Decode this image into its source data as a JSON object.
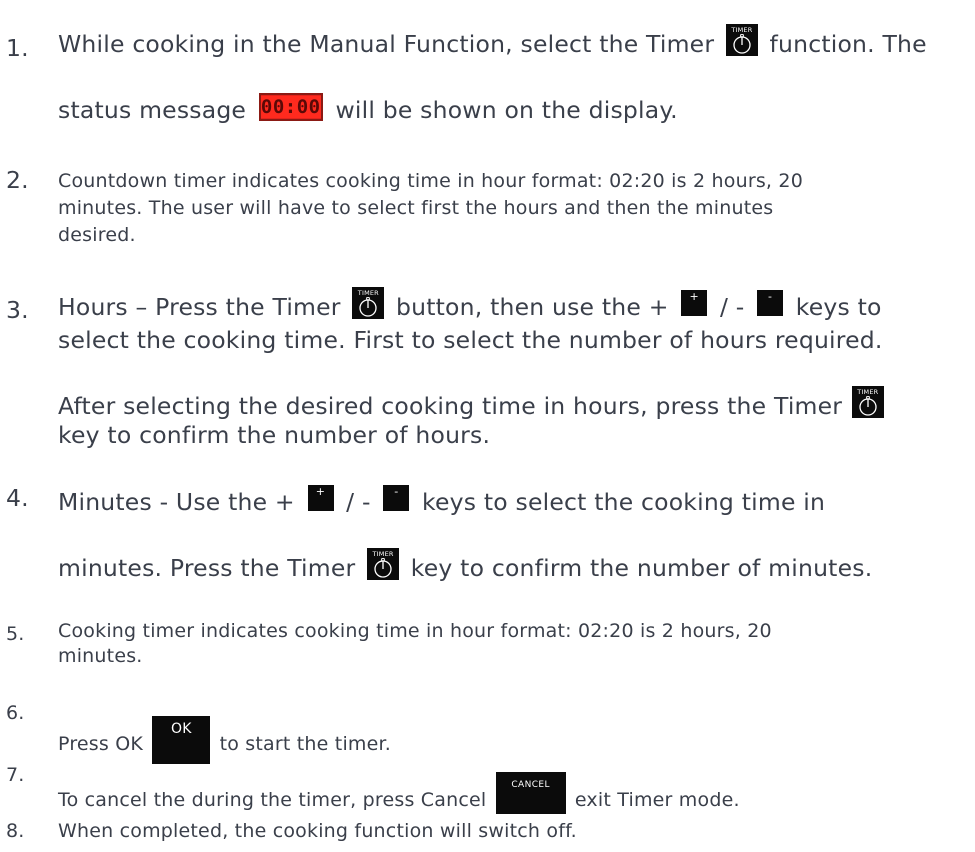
{
  "keys": {
    "timer_label": "TIMER",
    "plus_label": "+",
    "minus_label": "-",
    "ok_label": "OK",
    "cancel_label": "CANCEL",
    "status_display": "00:00"
  },
  "steps": [
    {
      "num": "1.",
      "l1a": "While cooking in the Manual Function, select the Timer",
      "l1b": "function. The",
      "l2a": "status message",
      "l2b": "will be shown on the display."
    },
    {
      "num": "2.",
      "l1": "Countdown timer indicates cooking time in hour format: 02:20 is 2 hours, 20",
      "l2": "minutes. The user will have to select first the hours and then the minutes",
      "l3": "desired."
    },
    {
      "num": "3.",
      "l1a": "Hours – Press the Timer",
      "l1b": "button, then use the +",
      "l1c": "/ -",
      "l1d": "keys to",
      "l2": "select the cooking time. First to select the number of hours required.",
      "l3a": "After selecting the desired cooking time in hours, press the Timer",
      "l4": "key to confirm the number of hours."
    },
    {
      "num": "4.",
      "l1a": "Minutes - Use the +",
      "l1b": "/ -",
      "l1c": "keys to select the cooking time in",
      "l2a": "minutes. Press the Timer",
      "l2b": "key to confirm the number of minutes."
    },
    {
      "num": "5.",
      "l1": "Cooking timer indicates cooking time in hour format: 02:20 is 2 hours, 20",
      "l2": "minutes."
    },
    {
      "num": "6.",
      "l1a": "Press OK",
      "l1b": "to start the timer."
    },
    {
      "num": "7.",
      "l1a": "To cancel the during the timer, press Cancel",
      "l1b": "exit Timer mode."
    },
    {
      "num": "8.",
      "l1": "When completed, the cooking function will switch off."
    }
  ]
}
